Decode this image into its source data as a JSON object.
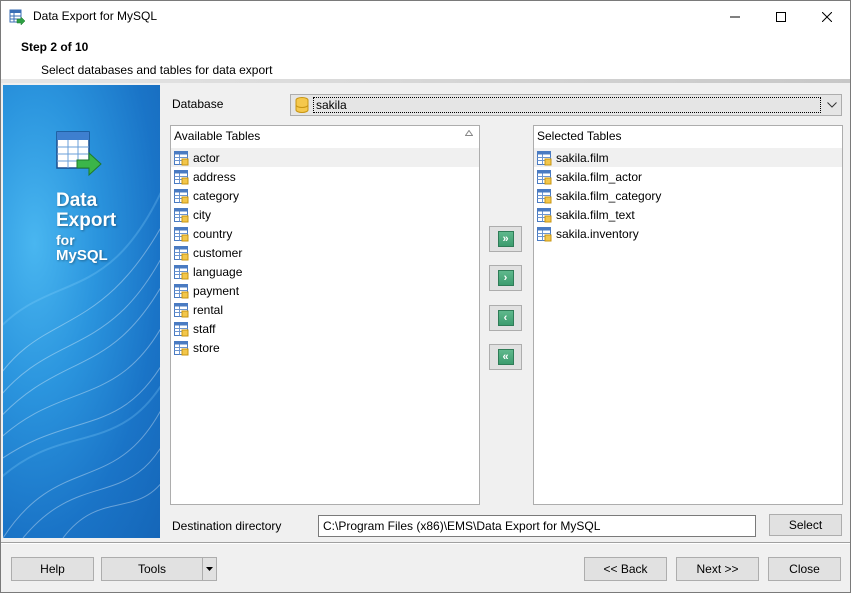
{
  "window": {
    "title": "Data Export for MySQL"
  },
  "header": {
    "step": "Step 2 of 10",
    "description": "Select databases and tables for data export"
  },
  "banner": {
    "line1": "Data",
    "line2": "Export",
    "line3": "for",
    "line4": "MySQL"
  },
  "database": {
    "label": "Database",
    "value": "sakila"
  },
  "available": {
    "header": "Available Tables",
    "items": [
      "actor",
      "address",
      "category",
      "city",
      "country",
      "customer",
      "language",
      "payment",
      "rental",
      "staff",
      "store"
    ]
  },
  "selected": {
    "header": "Selected Tables",
    "items": [
      "sakila.film",
      "sakila.film_actor",
      "sakila.film_category",
      "sakila.film_text",
      "sakila.inventory"
    ]
  },
  "move_buttons": {
    "add_all": "»",
    "add": "›",
    "remove": "‹",
    "remove_all": "«"
  },
  "destination": {
    "label": "Destination directory",
    "value": "C:\\Program Files (x86)\\EMS\\Data Export for MySQL",
    "select_label": "Select"
  },
  "footer": {
    "help": "Help",
    "tools": "Tools",
    "back": "<< Back",
    "next": "Next >>",
    "close": "Close"
  }
}
